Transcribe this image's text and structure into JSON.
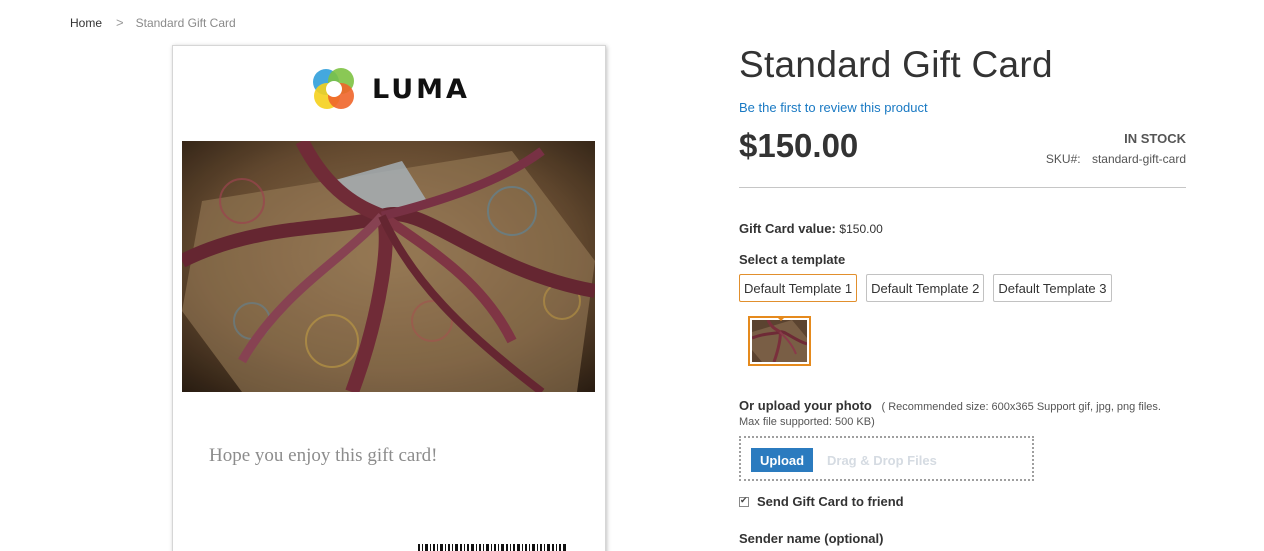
{
  "breadcrumb": {
    "home": "Home",
    "separator": ">",
    "current": "Standard Gift Card"
  },
  "card": {
    "logo_text": "LUMA",
    "image": "gift-box-photo",
    "message": "Hope you enjoy this gift card!"
  },
  "product": {
    "title": "Standard Gift Card",
    "review_link": "Be the first to review this product",
    "price": "$150.00",
    "stock": "In stock",
    "sku_label": "SKU#:",
    "sku_value": "standard-gift-card"
  },
  "options": {
    "value_label": "Gift Card value:",
    "value": "$150.00",
    "template_heading": "Select a template",
    "templates": [
      {
        "label": "Default Template 1",
        "selected": true
      },
      {
        "label": "Default Template 2",
        "selected": false
      },
      {
        "label": "Default Template 3",
        "selected": false
      }
    ],
    "upload_label": "Or upload your photo",
    "upload_hint": "( Recommended size: 600x365 Support gif, jpg, png files.",
    "upload_hint2": "Max file supported: 500 KB)",
    "upload_button": "Upload",
    "drop_text": "Drag & Drop Files",
    "send_to_friend": "Send Gift Card to friend",
    "send_to_friend_checked": true,
    "sender_label": "Sender name (optional)"
  },
  "colors": {
    "accent": "#e58a1d",
    "link": "#1979c3",
    "button": "#2b7bbf"
  }
}
